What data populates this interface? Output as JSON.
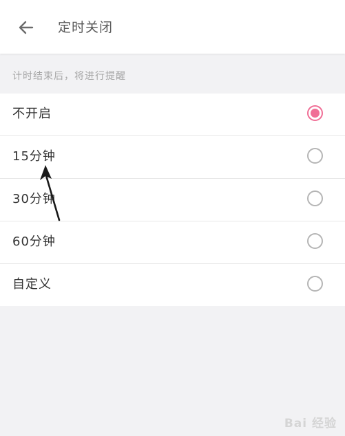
{
  "header": {
    "title": "定时关闭",
    "back_icon": "arrow-left-icon"
  },
  "hint": "计时结束后，将进行提醒",
  "options": [
    {
      "label": "不开启",
      "selected": true
    },
    {
      "label": "15分钟",
      "selected": false
    },
    {
      "label": "30分钟",
      "selected": false
    },
    {
      "label": "60分钟",
      "selected": false
    },
    {
      "label": "自定义",
      "selected": false
    }
  ],
  "colors": {
    "accent": "#f06e96",
    "radio_border": "#b5b5b5",
    "hint_text": "#a6a6a6"
  },
  "watermark": "Bai 经验"
}
